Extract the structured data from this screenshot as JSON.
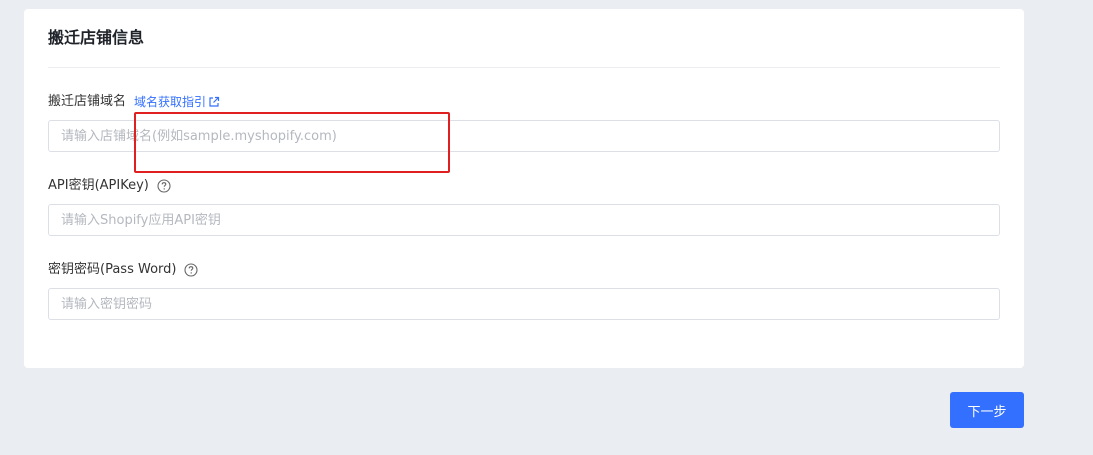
{
  "card": {
    "title": "搬迁店铺信息"
  },
  "fields": [
    {
      "label": "搬迁店铺域名",
      "link": "域名获取指引",
      "value": "",
      "placeholder": "请输入店铺域名(例如sample.myshopify.com)"
    },
    {
      "label": "API密钥(APIKey)",
      "value": "",
      "placeholder": "请输入Shopify应用API密钥"
    },
    {
      "label": "密钥密码(Pass Word)",
      "value": "",
      "placeholder": "请输入密钥密码"
    }
  ],
  "actions": {
    "next_label": "下一步"
  },
  "colors": {
    "accent": "#3370ff",
    "highlight": "#e02020",
    "background": "#eaedf1"
  },
  "icons": {
    "external_link": "external-link-icon",
    "help": "question-circle-icon"
  }
}
